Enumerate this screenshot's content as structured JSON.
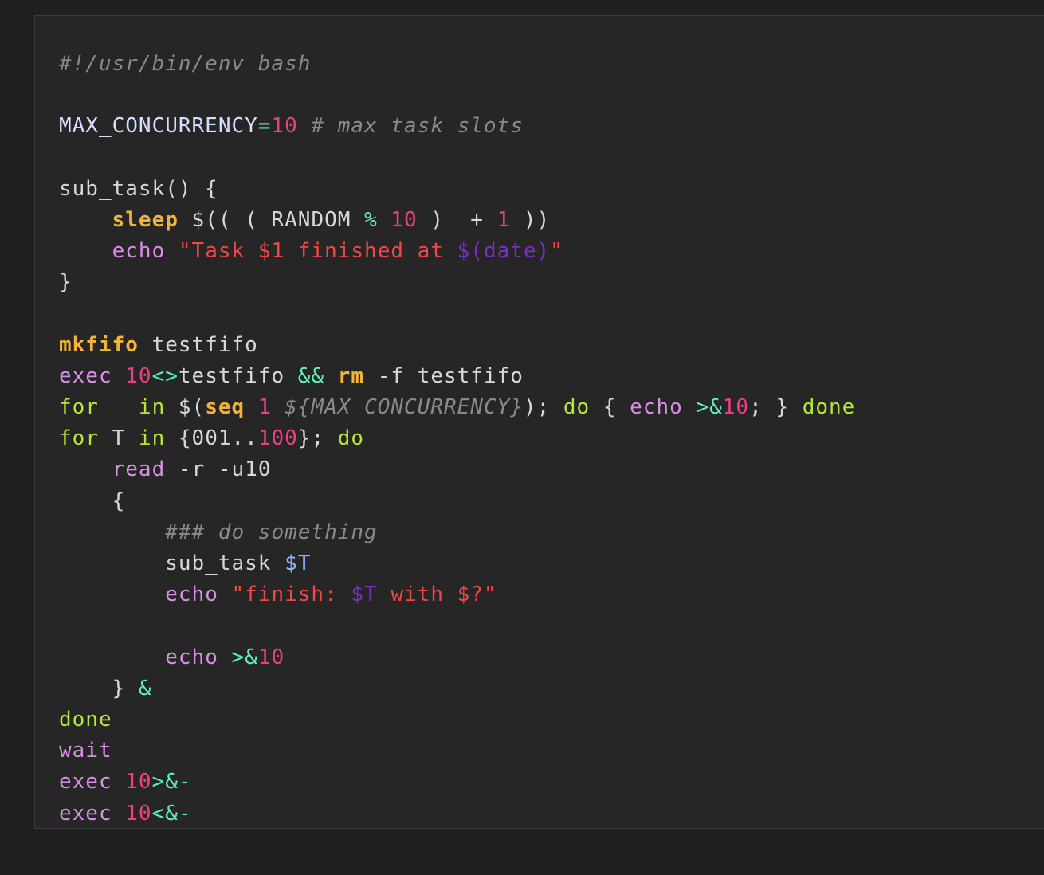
{
  "code": {
    "language": "bash",
    "lines": [
      [
        {
          "t": "#!/usr/bin/env bash",
          "c": "comment"
        }
      ],
      [],
      [
        {
          "t": "MAX_CONCURRENCY",
          "c": "var"
        },
        {
          "t": "=",
          "c": "op"
        },
        {
          "t": "10",
          "c": "num"
        },
        {
          "t": " ",
          "c": "plain"
        },
        {
          "t": "# max task slots",
          "c": "comment"
        }
      ],
      [],
      [
        {
          "t": "sub_task() {",
          "c": "plain"
        }
      ],
      [
        {
          "t": "    ",
          "c": "plain"
        },
        {
          "t": "sleep",
          "c": "builtin"
        },
        {
          "t": " $(( ( RANDOM ",
          "c": "plain"
        },
        {
          "t": "%",
          "c": "op"
        },
        {
          "t": " ",
          "c": "plain"
        },
        {
          "t": "10",
          "c": "num"
        },
        {
          "t": " )  + ",
          "c": "plain"
        },
        {
          "t": "1",
          "c": "num"
        },
        {
          "t": " ))",
          "c": "plain"
        }
      ],
      [
        {
          "t": "    ",
          "c": "plain"
        },
        {
          "t": "echo",
          "c": "cmd"
        },
        {
          "t": " ",
          "c": "plain"
        },
        {
          "t": "\"Task $1 finished at ",
          "c": "str"
        },
        {
          "t": "$(date)",
          "c": "subst"
        },
        {
          "t": "\"",
          "c": "str"
        }
      ],
      [
        {
          "t": "}",
          "c": "plain"
        }
      ],
      [],
      [
        {
          "t": "mkfifo",
          "c": "builtin"
        },
        {
          "t": " testfifo",
          "c": "plain"
        }
      ],
      [
        {
          "t": "exec",
          "c": "cmd"
        },
        {
          "t": " ",
          "c": "plain"
        },
        {
          "t": "10",
          "c": "num"
        },
        {
          "t": "<>",
          "c": "op"
        },
        {
          "t": "testfifo ",
          "c": "plain"
        },
        {
          "t": "&&",
          "c": "op"
        },
        {
          "t": " ",
          "c": "plain"
        },
        {
          "t": "rm",
          "c": "builtin"
        },
        {
          "t": " -f testfifo",
          "c": "plain"
        }
      ],
      [
        {
          "t": "for",
          "c": "kw"
        },
        {
          "t": " _ ",
          "c": "plain"
        },
        {
          "t": "in",
          "c": "kw"
        },
        {
          "t": " $(",
          "c": "plain"
        },
        {
          "t": "seq",
          "c": "builtin"
        },
        {
          "t": " ",
          "c": "plain"
        },
        {
          "t": "1",
          "c": "num"
        },
        {
          "t": " ",
          "c": "plain"
        },
        {
          "t": "${MAX_CONCURRENCY}",
          "c": "italic"
        },
        {
          "t": "); ",
          "c": "plain"
        },
        {
          "t": "do",
          "c": "kw"
        },
        {
          "t": " { ",
          "c": "plain"
        },
        {
          "t": "echo",
          "c": "cmd"
        },
        {
          "t": " ",
          "c": "plain"
        },
        {
          "t": ">&",
          "c": "op"
        },
        {
          "t": "10",
          "c": "num"
        },
        {
          "t": "; } ",
          "c": "plain"
        },
        {
          "t": "done",
          "c": "kw"
        }
      ],
      [
        {
          "t": "for",
          "c": "kw"
        },
        {
          "t": " T ",
          "c": "plain"
        },
        {
          "t": "in",
          "c": "kw"
        },
        {
          "t": " {001..",
          "c": "plain"
        },
        {
          "t": "100",
          "c": "num"
        },
        {
          "t": "}; ",
          "c": "plain"
        },
        {
          "t": "do",
          "c": "kw"
        }
      ],
      [
        {
          "t": "    ",
          "c": "plain"
        },
        {
          "t": "read",
          "c": "cmd"
        },
        {
          "t": " -r -u10",
          "c": "plain"
        }
      ],
      [
        {
          "t": "    {",
          "c": "plain"
        }
      ],
      [
        {
          "t": "        ",
          "c": "plain"
        },
        {
          "t": "### do something",
          "c": "comment"
        }
      ],
      [
        {
          "t": "        sub_task ",
          "c": "plain"
        },
        {
          "t": "$T",
          "c": "varref"
        }
      ],
      [
        {
          "t": "        ",
          "c": "plain"
        },
        {
          "t": "echo",
          "c": "cmd"
        },
        {
          "t": " ",
          "c": "plain"
        },
        {
          "t": "\"finish: ",
          "c": "str"
        },
        {
          "t": "$T",
          "c": "subst"
        },
        {
          "t": " with $?\"",
          "c": "str"
        }
      ],
      [],
      [
        {
          "t": "        ",
          "c": "plain"
        },
        {
          "t": "echo",
          "c": "cmd"
        },
        {
          "t": " ",
          "c": "plain"
        },
        {
          "t": ">&",
          "c": "op"
        },
        {
          "t": "10",
          "c": "num"
        }
      ],
      [
        {
          "t": "    } ",
          "c": "plain"
        },
        {
          "t": "&",
          "c": "op"
        }
      ],
      [
        {
          "t": "done",
          "c": "kw"
        }
      ],
      [
        {
          "t": "wait",
          "c": "cmd"
        }
      ],
      [
        {
          "t": "exec",
          "c": "cmd"
        },
        {
          "t": " ",
          "c": "plain"
        },
        {
          "t": "10",
          "c": "num"
        },
        {
          "t": ">&-",
          "c": "op"
        }
      ],
      [
        {
          "t": "exec",
          "c": "cmd"
        },
        {
          "t": " ",
          "c": "plain"
        },
        {
          "t": "10",
          "c": "num"
        },
        {
          "t": "<&-",
          "c": "op"
        }
      ]
    ]
  },
  "colors": {
    "page_background": "#1f1f1f",
    "block_background": "#262626",
    "comment": "#8a8a8a",
    "variable": "#d6deff",
    "operator": "#5ff0b5",
    "number": "#ef3d86",
    "builtin": "#f2b33a",
    "command": "#da8ee8",
    "string": "#f04848",
    "substitution": "#7a2ec4",
    "keyword": "#b3e63a",
    "variable_reference": "#8fb7ff"
  }
}
